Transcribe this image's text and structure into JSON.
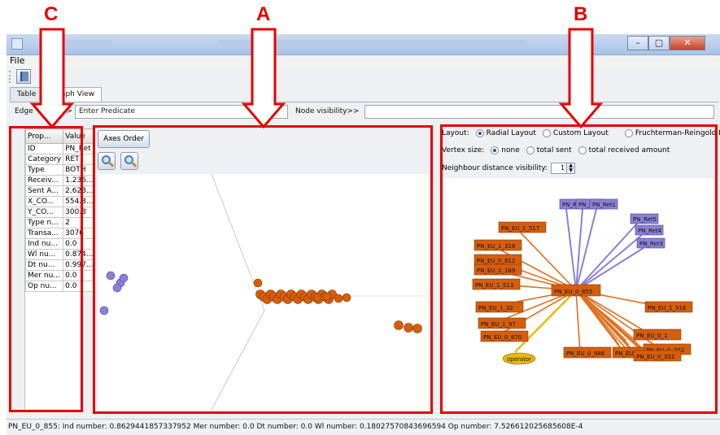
{
  "window": {
    "title_bar_icon": "java-app-icon",
    "buttons": [
      "–",
      "▢",
      "✕"
    ]
  },
  "menu": {
    "file_label": "File"
  },
  "tabs": [
    {
      "label": "Table",
      "active": false
    },
    {
      "label": "Graph View",
      "active": true
    }
  ],
  "filter_bar": {
    "edge_label": "Edge",
    "edge_arrows": ">>",
    "predicate_placeholder": "Enter Predicate",
    "node_visibility_label": "Node visibility>>",
    "node_visibility_value": ""
  },
  "property_table": {
    "headers": [
      "Prop...",
      "Value"
    ],
    "rows": [
      [
        "ID",
        "PN_Ret"
      ],
      [
        "Category",
        "RET"
      ],
      [
        "Type",
        "BOTH"
      ],
      [
        "Receiv...",
        "1.236..."
      ],
      [
        "Sent A...",
        "2.623..."
      ],
      [
        "X_CO...",
        "554.8..."
      ],
      [
        "Y_CO...",
        "300.8"
      ],
      [
        "Type n...",
        "2"
      ],
      [
        "Transa...",
        "3076"
      ],
      [
        "Ind nu...",
        "0.0"
      ],
      [
        "Wl nu...",
        "0.874..."
      ],
      [
        "Dt nu...",
        "0.997..."
      ],
      [
        "Mer nu...",
        "0.0"
      ],
      [
        "Op nu...",
        "0.0"
      ]
    ]
  },
  "center_panel": {
    "axes_order_label": "Axes Order",
    "zoom_out_icon": "zoom-out-icon",
    "zoom_in_icon": "zoom-in-icon"
  },
  "right_panel": {
    "layout_label": "Layout:",
    "layout_options": [
      {
        "label": "Radial Layout",
        "selected": true
      },
      {
        "label": "Custom Layout",
        "selected": false
      },
      {
        "label": "Fruchterman-Reingold Layout",
        "selected": false
      }
    ],
    "vertex_size_label": "Vertex size:",
    "vertex_size_options": [
      {
        "label": "none",
        "selected": true
      },
      {
        "label": "total sent",
        "selected": false
      },
      {
        "label": "total received amount",
        "selected": false
      }
    ],
    "neighbour_label": "Neighbour distance visibility:",
    "neighbour_value": "1",
    "graph": {
      "center_node": "PN_EU_0_855",
      "orange_nodes": [
        "PN_EU_1_517",
        "PN_EU_1_318",
        "PN_EU_0_812",
        "PN_EU_2_169",
        "PN_EU_1_513",
        "PN_EU_1_32",
        "PN_EU_1_97",
        "PN_EU_0_670",
        "PN_EU_1_516",
        "PN_EU_0_986",
        "PN_EU_0_7",
        "PN_EU_0_1",
        "PN_EU_0_722",
        "PN_EU_0_332"
      ],
      "purple_nodes": [
        "PN_Ret6",
        "PN_Ret2",
        "PN_Ret1",
        "PN_Ret5",
        "PN_Ret4",
        "PN_Ret3"
      ],
      "operator_node": "operator"
    }
  },
  "status_bar": {
    "text": "PN_EU_0_855: Ind number: 0.8629441857337952 Mer number: 0.0 Dt number: 0.0 Wl number: 0.18027570843696594 Op number: 7.526612025685608E-4"
  },
  "annotations": {
    "letters": [
      "C",
      "A",
      "B"
    ]
  },
  "colors": {
    "annotation": "#e60000",
    "orange_node": "#d55e0c",
    "purple_node": "#8a80d6",
    "edge_orange": "#e07020",
    "edge_purple": "#8a80d6",
    "edge_yellow": "#e8b800"
  }
}
